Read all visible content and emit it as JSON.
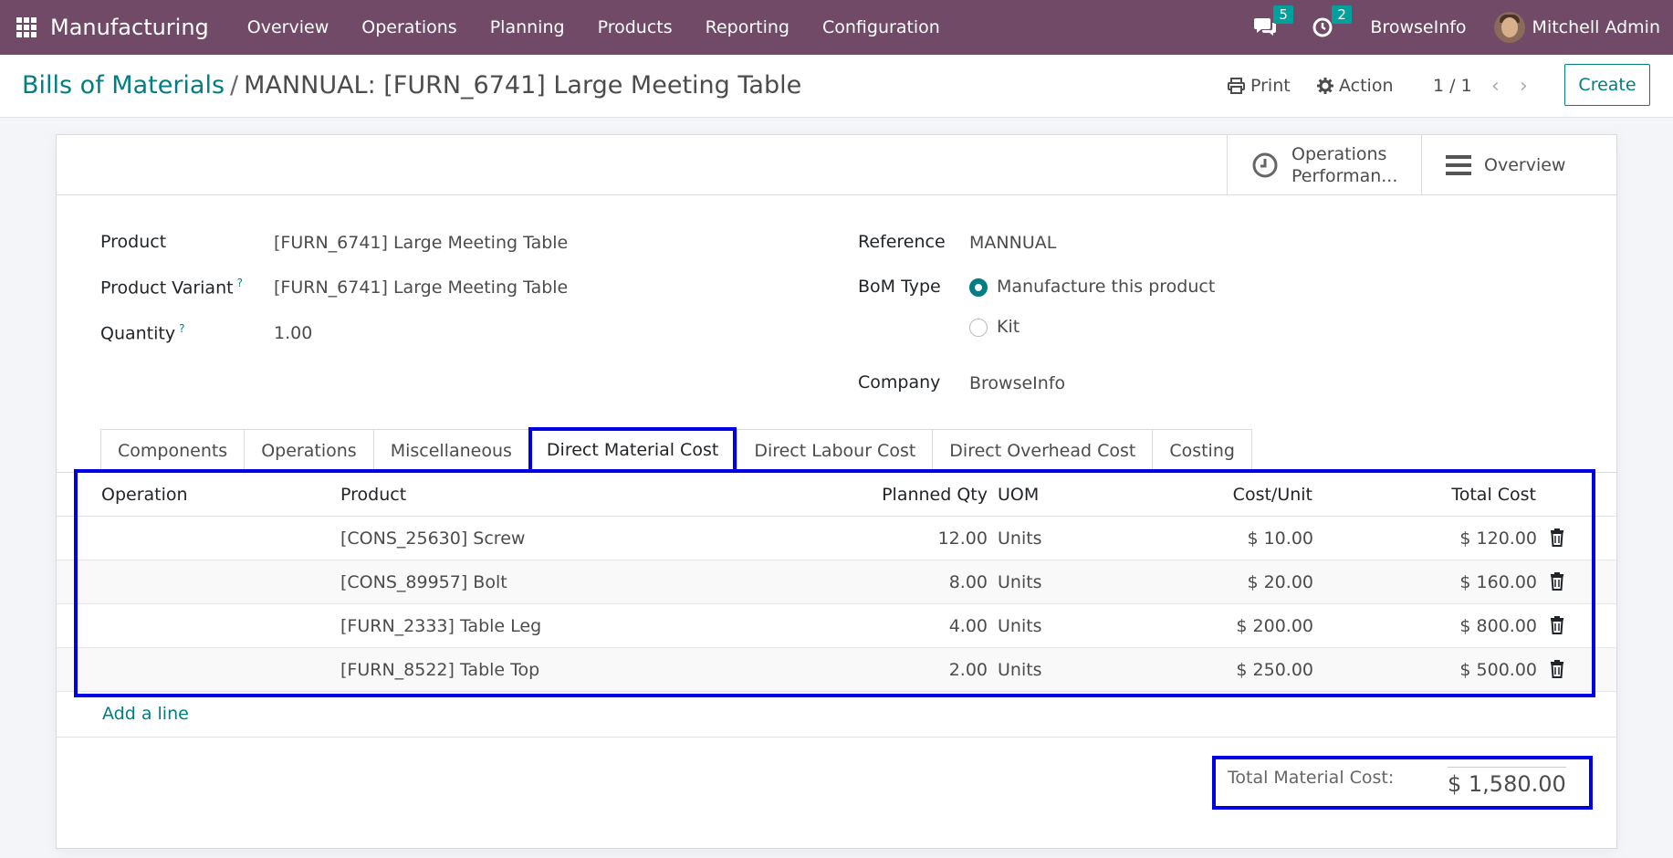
{
  "navbar": {
    "app_name": "Manufacturing",
    "menu": [
      "Overview",
      "Operations",
      "Planning",
      "Products",
      "Reporting",
      "Configuration"
    ],
    "messages_count": "5",
    "activities_count": "2",
    "company": "BrowseInfo",
    "user": "Mitchell Admin"
  },
  "control": {
    "breadcrumb_parent": "Bills of Materials",
    "breadcrumb_separator": "/",
    "breadcrumb_current": "MANNUAL: [FURN_6741] Large Meeting Table",
    "print_label": "Print",
    "action_label": "Action",
    "pager": "1 / 1",
    "create_label": "Create"
  },
  "stat_buttons": {
    "operations_performance": [
      "Operations",
      "Performan..."
    ],
    "overview": "Overview"
  },
  "form": {
    "product_label": "Product",
    "product_value": "[FURN_6741] Large Meeting Table",
    "variant_label": "Product Variant",
    "variant_value": "[FURN_6741] Large Meeting Table",
    "quantity_label": "Quantity",
    "quantity_value": "1.00",
    "help_mark": "?",
    "reference_label": "Reference",
    "reference_value": "MANNUAL",
    "bom_type_label": "BoM Type",
    "bom_type_options": [
      "Manufacture this product",
      "Kit"
    ],
    "bom_type_selected": "Manufacture this product",
    "company_label": "Company",
    "company_value": "BrowseInfo"
  },
  "tabs": [
    "Components",
    "Operations",
    "Miscellaneous",
    "Direct Material Cost",
    "Direct Labour Cost",
    "Direct Overhead Cost",
    "Costing"
  ],
  "active_tab": "Direct Material Cost",
  "table": {
    "headers": {
      "operation": "Operation",
      "product": "Product",
      "planned_qty": "Planned Qty",
      "uom": "UOM",
      "cost_unit": "Cost/Unit",
      "total_cost": "Total Cost"
    },
    "rows": [
      {
        "operation": "",
        "product": "[CONS_25630] Screw",
        "planned_qty": "12.00",
        "uom": "Units",
        "cost_unit": "$ 10.00",
        "total_cost": "$ 120.00"
      },
      {
        "operation": "",
        "product": "[CONS_89957] Bolt",
        "planned_qty": "8.00",
        "uom": "Units",
        "cost_unit": "$ 20.00",
        "total_cost": "$ 160.00"
      },
      {
        "operation": "",
        "product": "[FURN_2333] Table Leg",
        "planned_qty": "4.00",
        "uom": "Units",
        "cost_unit": "$ 200.00",
        "total_cost": "$ 800.00"
      },
      {
        "operation": "",
        "product": "[FURN_8522] Table Top",
        "planned_qty": "2.00",
        "uom": "Units",
        "cost_unit": "$ 250.00",
        "total_cost": "$ 500.00"
      }
    ],
    "add_line": "Add a line"
  },
  "totals": {
    "label": "Total Material Cost:",
    "value": "$ 1,580.00"
  },
  "colors": {
    "navbar": "#704a66",
    "accent": "#017e84",
    "badge": "#00a09d",
    "highlight": "#0000e6"
  }
}
